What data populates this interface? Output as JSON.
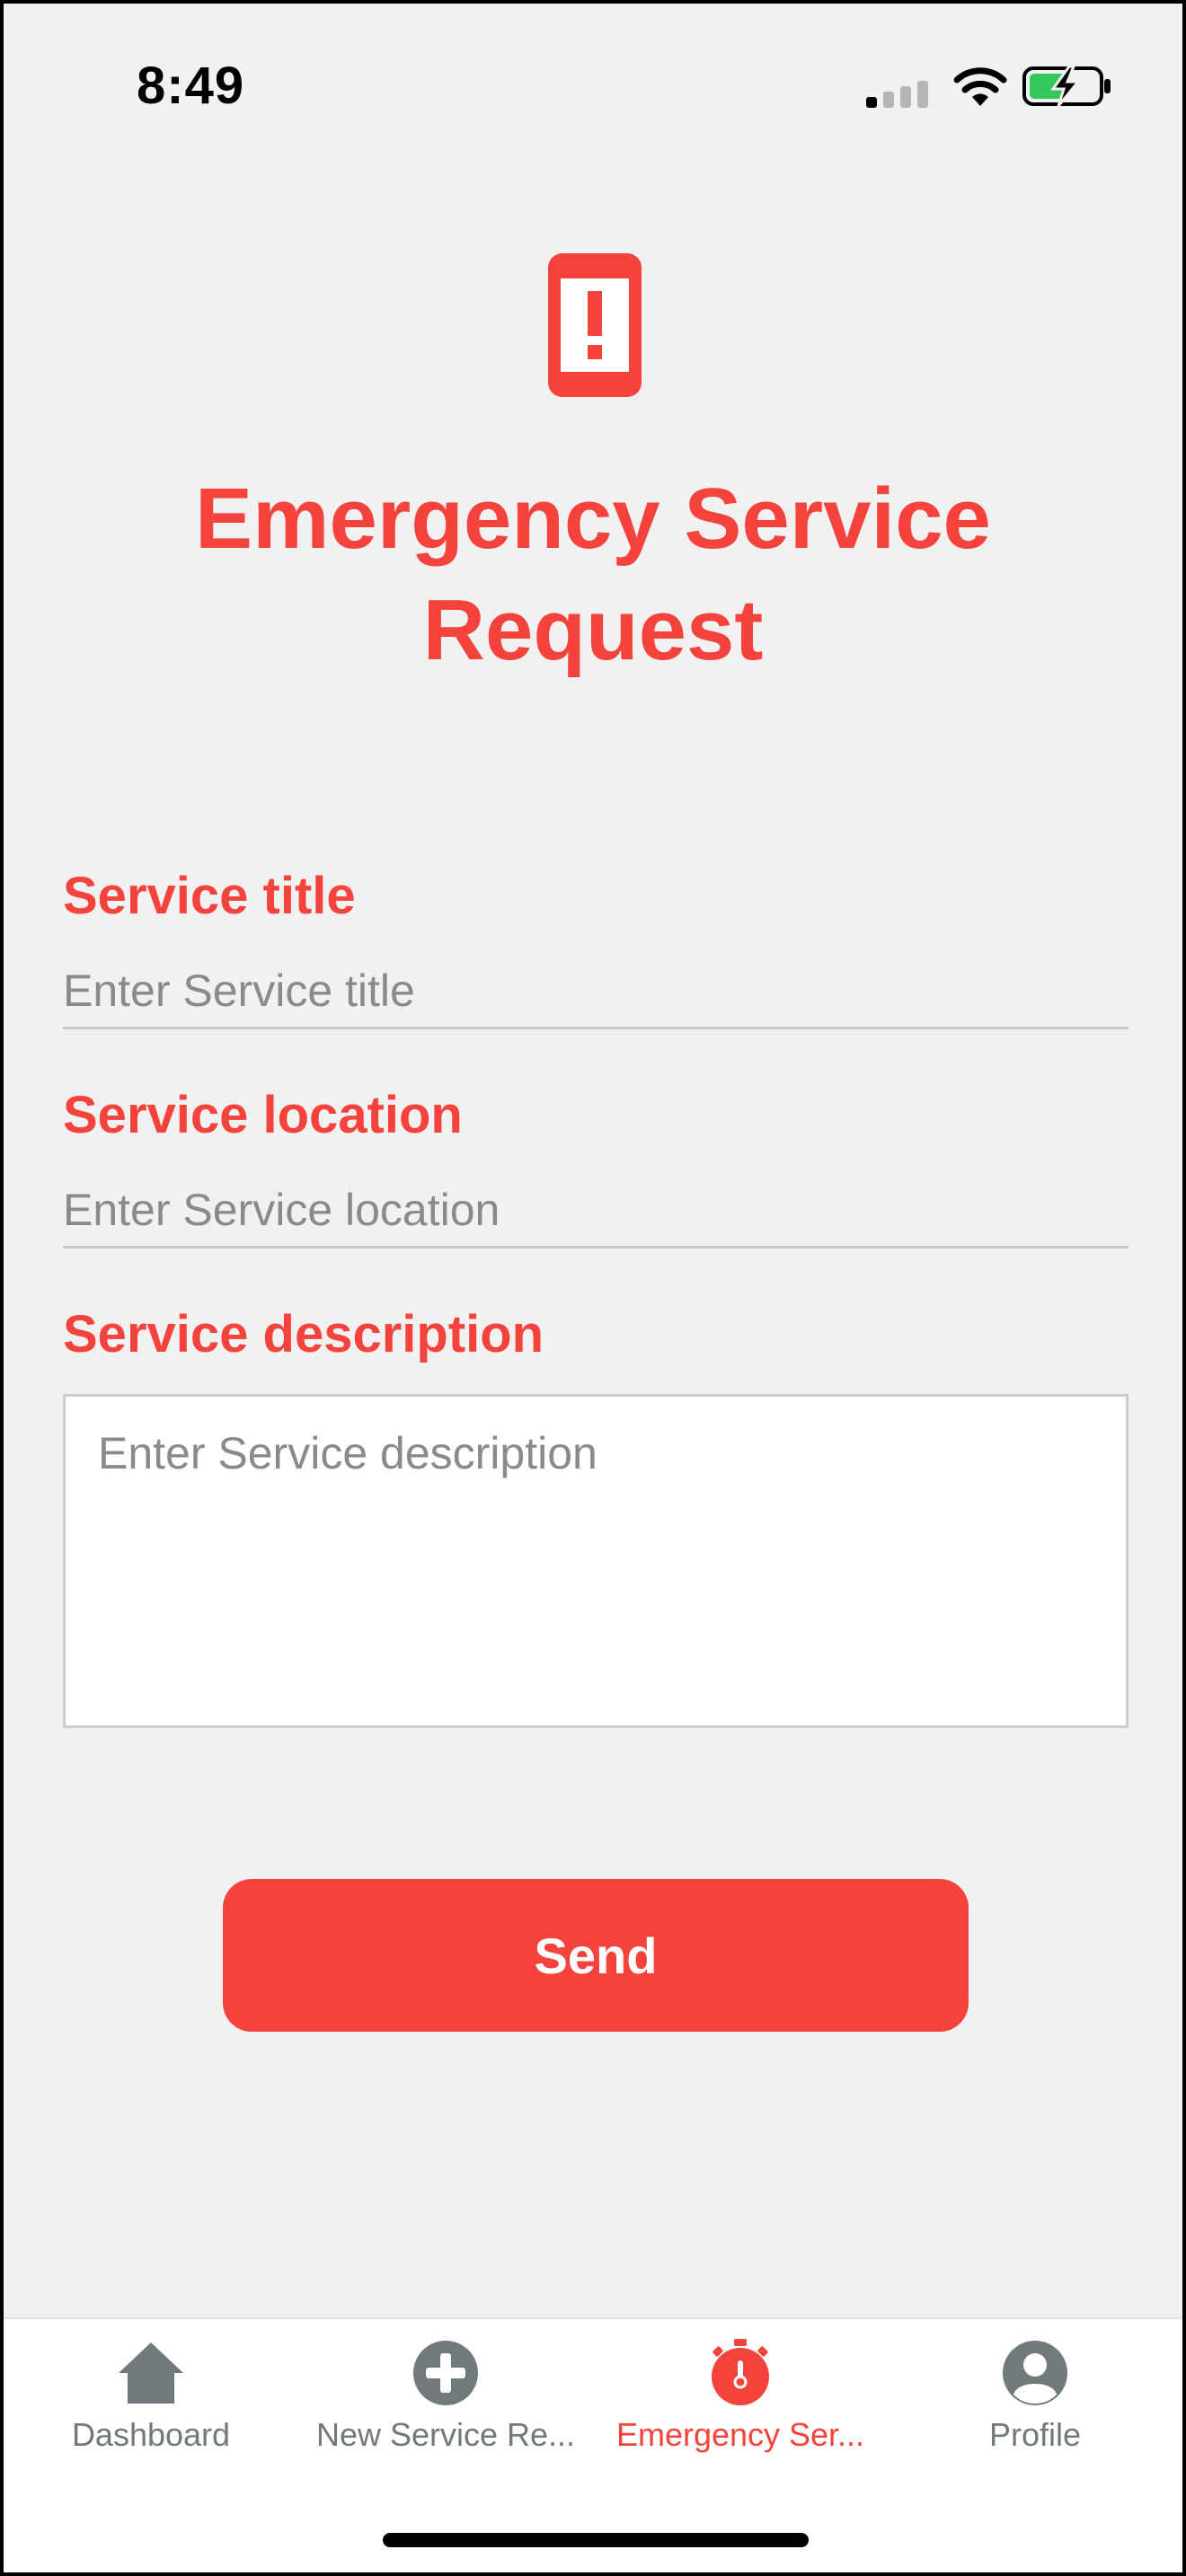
{
  "status_bar": {
    "time": "8:49",
    "icons": [
      "cellular-signal-icon",
      "wifi-icon",
      "battery-charging-icon"
    ]
  },
  "header": {
    "icon": "phone-alert-icon",
    "title": "Emergency Service Request"
  },
  "form": {
    "title_label": "Service title",
    "title_placeholder": "Enter Service title",
    "title_value": "",
    "location_label": "Service location",
    "location_placeholder": "Enter Service location",
    "location_value": "",
    "description_label": "Service description",
    "description_placeholder": "Enter Service description",
    "description_value": "",
    "send_label": "Send"
  },
  "tab_bar": {
    "items": [
      {
        "label": "Dashboard",
        "icon": "home-icon",
        "active": false
      },
      {
        "label": "New Service Re...",
        "icon": "plus-circle-icon",
        "active": false
      },
      {
        "label": "Emergency Ser...",
        "icon": "stopwatch-icon",
        "active": true
      },
      {
        "label": "Profile",
        "icon": "user-circle-icon",
        "active": false
      }
    ]
  },
  "colors": {
    "accent": "#f4433c",
    "inactive": "#707a7c",
    "background": "#f1f1f1"
  }
}
